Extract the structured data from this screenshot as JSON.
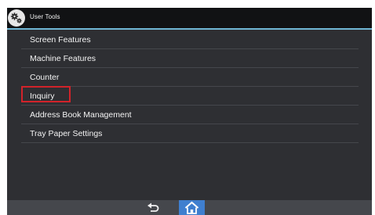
{
  "header": {
    "title": "User Tools",
    "icon": "gear-icon"
  },
  "menu": {
    "items": [
      {
        "label": "Screen Features"
      },
      {
        "label": "Machine Features"
      },
      {
        "label": "Counter"
      },
      {
        "label": "Inquiry",
        "highlighted": true
      },
      {
        "label": "Address Book Management"
      },
      {
        "label": "Tray Paper Settings"
      }
    ]
  },
  "footer": {
    "back_icon": "back-arrow-icon",
    "home_icon": "home-icon"
  },
  "colors": {
    "accent": "#6fb6d4",
    "highlight": "#d2232a",
    "home_button": "#3f7fcf"
  }
}
